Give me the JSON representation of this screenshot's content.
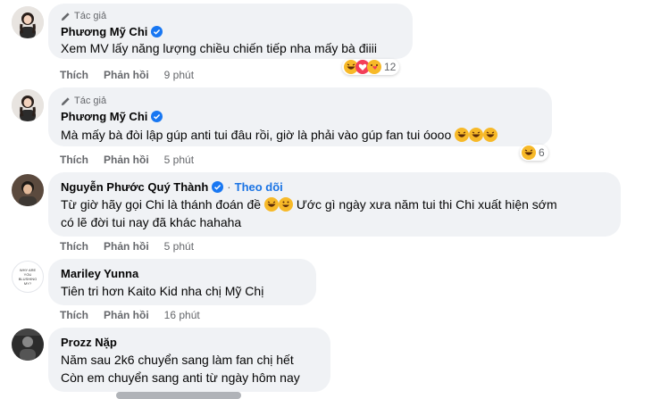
{
  "comments": [
    {
      "author_tag": "Tác giả",
      "name": "Phương Mỹ Chi",
      "text": "Xem MV lấy năng lượng chiều chiến tiếp nha mấy bà điiii",
      "like": "Thích",
      "reply": "Phản hồi",
      "time": "9 phút",
      "reaction_count": "12"
    },
    {
      "author_tag": "Tác giả",
      "name": "Phương Mỹ Chi",
      "text": "Mà mấy bà đòi lập gúp anti tui đâu rồi, giờ là phải vào gúp fan tui óooo",
      "like": "Thích",
      "reply": "Phản hồi",
      "time": "5 phút",
      "reaction_count": "6"
    },
    {
      "name": "Nguyễn Phước Quý Thành",
      "follow": "Theo dõi",
      "text_line1a": "Từ giờ hãy gọi Chi là thánh đoán đề",
      "text_line1b": "Ước gì ngày xưa năm tui thi Chi xuất hiện sớm",
      "text_line2": "có lẽ đời tui nay đã khác hahaha",
      "like": "Thích",
      "reply": "Phản hồi",
      "time": "5 phút"
    },
    {
      "name": "Mariley Yunna",
      "text": "Tiên tri hơn Kaito Kid nha chị Mỹ Chị",
      "like": "Thích",
      "reply": "Phản hồi",
      "time": "16 phút",
      "avatar_text": "WHY ARE YOU BLUSHING MY?"
    },
    {
      "name": "Prozz Nặp",
      "text_line1": "Năm sau 2k6 chuyển sang làm fan chị hết",
      "text_line2": "Còn em chuyển sang anti từ ngày hôm nay"
    }
  ],
  "icons": {
    "pen": "pencil-icon",
    "verified": "verified-badge-icon",
    "laugh": "haha-emoji",
    "love": "love-emoji",
    "care": "care-emoji"
  },
  "colors": {
    "bubble": "#f0f2f5",
    "link": "#1b74e4",
    "meta": "#65676b",
    "verified": "#1877f2"
  }
}
